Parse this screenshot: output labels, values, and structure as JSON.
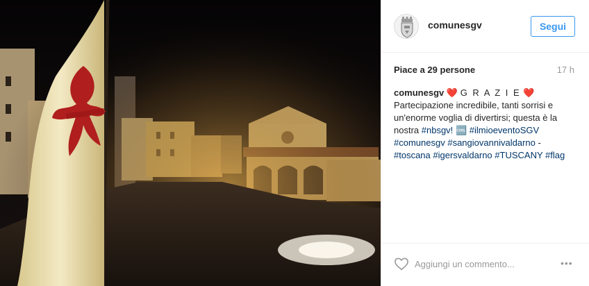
{
  "post": {
    "username": "comunesgv",
    "follow_label": "Segui",
    "likes_text": "Piace a 29 persone",
    "time_ago": "17 h",
    "caption": {
      "username": "comunesgv",
      "heart": "❤️",
      "grazie": "G R A Z I E",
      "text1": "Partecipazione incredibile, tanti sorrisi e un'enorme voglia di divertirsi; questa è la nostra",
      "hashtags": [
        "#nbsgv!",
        "#ilmioeventoSGV",
        "#comunesgv",
        "#sangiovannivaldarno",
        "#toscana",
        "#igersvaldarno",
        "#TUSCANY",
        "#flag"
      ],
      "emoji_box": "🆒",
      "dash": "-"
    },
    "comment_placeholder": "Aggiungi un commento...",
    "more_options": "•••"
  },
  "icons": {
    "avatar": "municipal-crest-icon",
    "like": "heart-outline-icon",
    "more": "more-options-icon"
  },
  "colors": {
    "accent": "#3897f0",
    "hashtag": "#003569",
    "heart": "#e02020",
    "muted": "#999999",
    "flag_red": "#b01e1e",
    "flag_cream": "#f0e6c2"
  }
}
